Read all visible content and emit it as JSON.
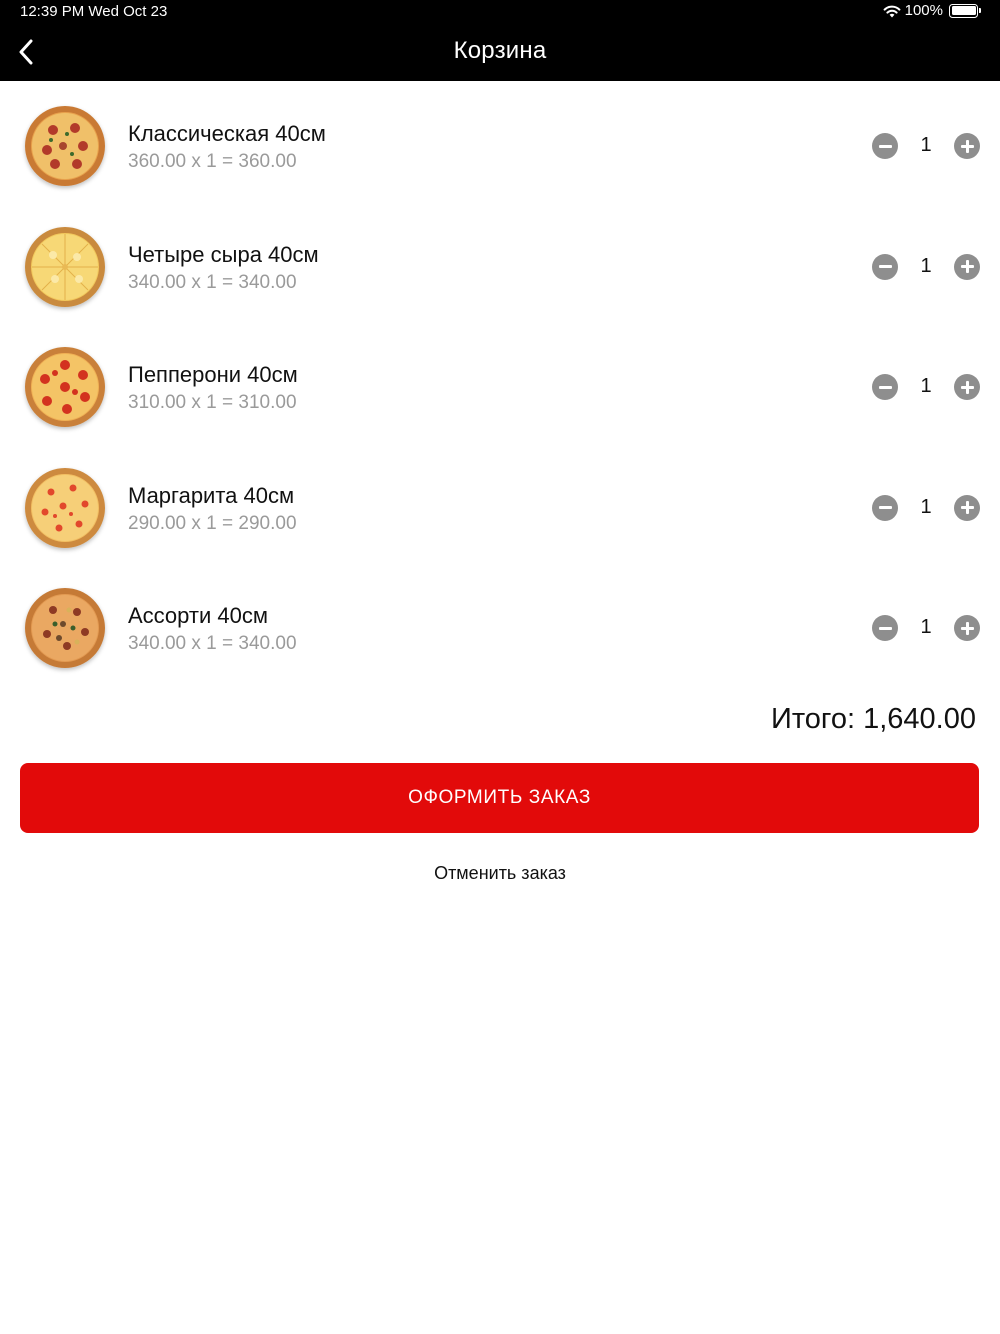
{
  "status_bar": {
    "time": "12:39 PM",
    "date": "Wed Oct 23",
    "battery": "100%"
  },
  "header": {
    "title": "Корзина",
    "back_icon": "chevron-left-icon"
  },
  "cart": {
    "items": [
      {
        "name": "Классическая 40см",
        "price_line": "360.00 x 1 = 360.00",
        "quantity": "1"
      },
      {
        "name": "Четыре сыра 40см",
        "price_line": "340.00 x 1 = 340.00",
        "quantity": "1"
      },
      {
        "name": "Пепперони 40см",
        "price_line": "310.00 x 1 = 310.00",
        "quantity": "1"
      },
      {
        "name": "Маргарита 40см",
        "price_line": "290.00 x 1 = 290.00",
        "quantity": "1"
      },
      {
        "name": "Ассорти 40см",
        "price_line": "340.00 x 1 = 340.00",
        "quantity": "1"
      }
    ],
    "total": "Итого: 1,640.00"
  },
  "actions": {
    "checkout_label": "ОФОРМИТЬ ЗАКАЗ",
    "cancel_label": "Отменить заказ"
  },
  "colors": {
    "header_bg": "#000000",
    "accent": "#e20a0a",
    "stepper": "#8e8e8e",
    "muted_text": "#9a9a9a"
  }
}
